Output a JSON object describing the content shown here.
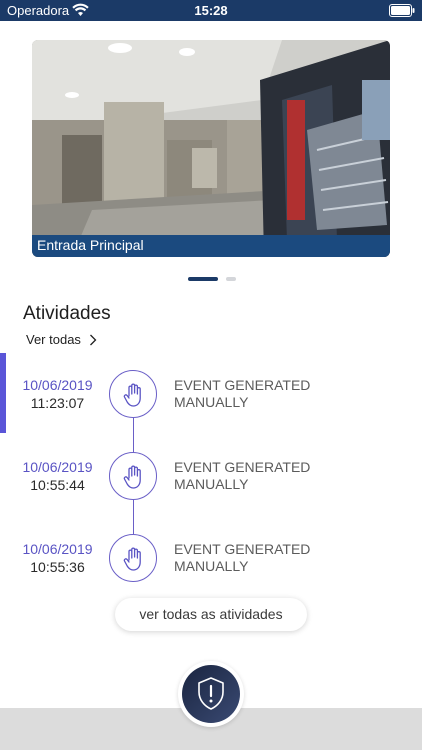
{
  "status_bar": {
    "carrier": "Operadora",
    "time": "15:28"
  },
  "camera": {
    "caption": "Entrada Principal"
  },
  "pager": {
    "page_count": 2,
    "active_index": 0
  },
  "activities": {
    "title": "Atividades",
    "see_all_label": "Ver todas",
    "events": [
      {
        "date": "10/06/2019",
        "time": "11:23:07",
        "description_line1": "EVENT GENERATED",
        "description_line2": "MANUALLY",
        "icon": "hand-icon"
      },
      {
        "date": "10/06/2019",
        "time": "10:55:44",
        "description_line1": "EVENT GENERATED",
        "description_line2": "MANUALLY",
        "icon": "hand-icon"
      },
      {
        "date": "10/06/2019",
        "time": "10:55:36",
        "description_line1": "EVENT GENERATED",
        "description_line2": "MANUALLY",
        "icon": "hand-icon"
      }
    ],
    "all_activities_button": "ver todas as atividades"
  },
  "alert_button": {
    "icon": "shield-alert-icon"
  },
  "colors": {
    "status_bar": "#1b3a67",
    "accent": "#5a54c4",
    "caption_bar": "#1b4a7f"
  }
}
